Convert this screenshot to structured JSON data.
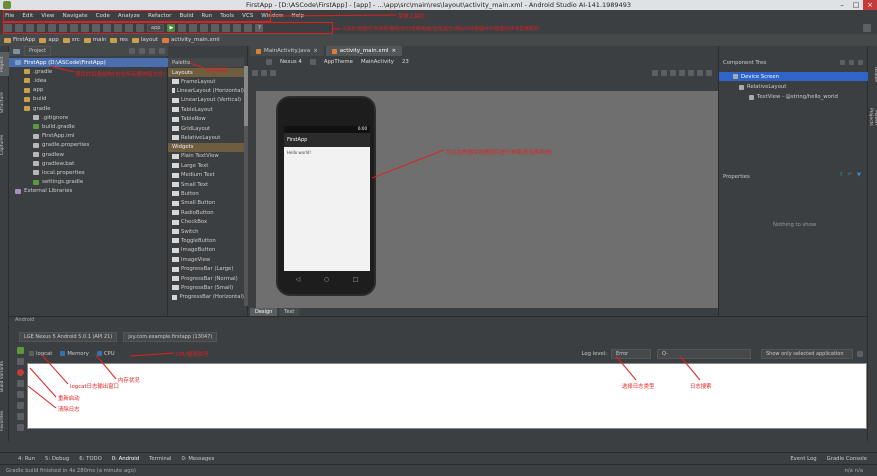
{
  "window": {
    "title": "FirstApp - [D:\\ASCode\\FirstApp] - [app] - ...\\app\\src\\main\\res\\layout\\activity_main.xml - Android Studio AI-141.1989493",
    "minimize": "–",
    "maximize": "□",
    "close": "×"
  },
  "menu": [
    "File",
    "Edit",
    "View",
    "Navigate",
    "Code",
    "Analyze",
    "Refactor",
    "Build",
    "Run",
    "Tools",
    "VCS",
    "Window",
    "Help"
  ],
  "toolbar": {
    "run_config": "app"
  },
  "nav": [
    "FirstApp",
    "app",
    "src",
    "main",
    "res",
    "layout",
    "activity_main.xml"
  ],
  "project_panel": {
    "selector": "Project",
    "tree": [
      {
        "label": "FirstApp (D:\\ASCode\\FirstApp)",
        "kind": "module",
        "indent": 0
      },
      {
        "label": ".gradle",
        "kind": "folder",
        "indent": 1
      },
      {
        "label": ".idea",
        "kind": "folder",
        "indent": 1
      },
      {
        "label": "app",
        "kind": "folder",
        "indent": 1
      },
      {
        "label": "build",
        "kind": "folder",
        "indent": 1
      },
      {
        "label": "gradle",
        "kind": "folder",
        "indent": 1
      },
      {
        "label": ".gitignore",
        "kind": "file",
        "indent": 2
      },
      {
        "label": "build.gradle",
        "kind": "gradle",
        "indent": 2
      },
      {
        "label": "FirstApp.iml",
        "kind": "file",
        "indent": 2
      },
      {
        "label": "gradle.properties",
        "kind": "file",
        "indent": 2
      },
      {
        "label": "gradlew",
        "kind": "file",
        "indent": 2
      },
      {
        "label": "gradlew.bat",
        "kind": "file",
        "indent": 2
      },
      {
        "label": "local.properties",
        "kind": "file",
        "indent": 2
      },
      {
        "label": "settings.gradle",
        "kind": "gradle",
        "indent": 2
      },
      {
        "label": "External Libraries",
        "kind": "lib",
        "indent": 0
      }
    ]
  },
  "side_tabs_left": [
    "Project",
    "Structure",
    "Captures"
  ],
  "side_tabs_left_bottom": [
    "Build Variants",
    "Favorites"
  ],
  "side_tabs_right": [
    "Gradle",
    "Maven Projects"
  ],
  "palette": {
    "title": "Palette",
    "groups": [
      {
        "header": "Layouts",
        "items": [
          "FrameLayout",
          "LinearLayout (Horizontal)",
          "LinearLayout (Vertical)",
          "TableLayout",
          "TableRow",
          "GridLayout",
          "RelativeLayout"
        ]
      },
      {
        "header": "Widgets",
        "items": [
          "Plain TextView",
          "Large Text",
          "Medium Text",
          "Small Text",
          "Button",
          "Small Button",
          "RadioButton",
          "CheckBox",
          "Switch",
          "ToggleButton",
          "ImageButton",
          "ImageView",
          "ProgressBar (Large)",
          "ProgressBar (Normal)",
          "ProgressBar (Small)",
          "ProgressBar (Horizontal)"
        ]
      }
    ]
  },
  "editor_tabs": [
    {
      "label": "MainActivity.java",
      "active": false
    },
    {
      "label": "activity_main.xml",
      "active": true
    }
  ],
  "editor_toolbar": [
    "Nexus 4",
    "AppTheme",
    "MainActivity",
    "23"
  ],
  "preview": {
    "app_title": "FirstApp",
    "status_time": "6:00",
    "hello": "Hello world!",
    "nav_back": "◁",
    "nav_home": "○",
    "nav_recent": "□"
  },
  "design_tabs": [
    "Design",
    "Text"
  ],
  "component_tree": {
    "title": "Component Tree",
    "items": [
      "Device Screen",
      "RelativeLayout",
      "TextView - @string/hello_world"
    ],
    "properties": "Properties",
    "nothing": "Nothing to show"
  },
  "bottom": {
    "title": "Android",
    "device": "LGE Nexus 5 Android 5.0.1 (API 21)",
    "process": "jxy.com.example.firstapp (13047)",
    "tabs": [
      "logcat",
      "Memory",
      "CPU"
    ],
    "log_level_label": "Log level:",
    "log_level": "Error",
    "search_placeholder": "Q-",
    "filter": "Show only selected application"
  },
  "status_tabs": [
    "4: Run",
    "5: Debug",
    "6: TODO",
    "0: Android",
    "Terminal",
    "0: Messages"
  ],
  "status_right": [
    "Event Log",
    "Gradle Console"
  ],
  "status_msg": "Gradle build finished in 4s 280ms (a minute ago)",
  "status_pos": "n/a  n/a",
  "annotations": {
    "menu_bar": "菜单工具栏",
    "toolbar_desc": "工具栏(新建/打开/保存/撤销/剪切/复制/粘贴/查找/运行/调试/SDK管理/AVD管理/同步等常用操作)",
    "project_tree": "项目的目录结构(包含所有模块和文件)",
    "palette": "组件面板",
    "preview": "可以在布局中拖拽控件进行布局(所见即所得)",
    "cpu": "CPU使用状况",
    "memory": "内存状况",
    "logcat": "logcat日志输出窗口",
    "restart": "重新启动",
    "clear": "清除日志",
    "log_level": "选择日志类型",
    "search": "日志搜索"
  }
}
